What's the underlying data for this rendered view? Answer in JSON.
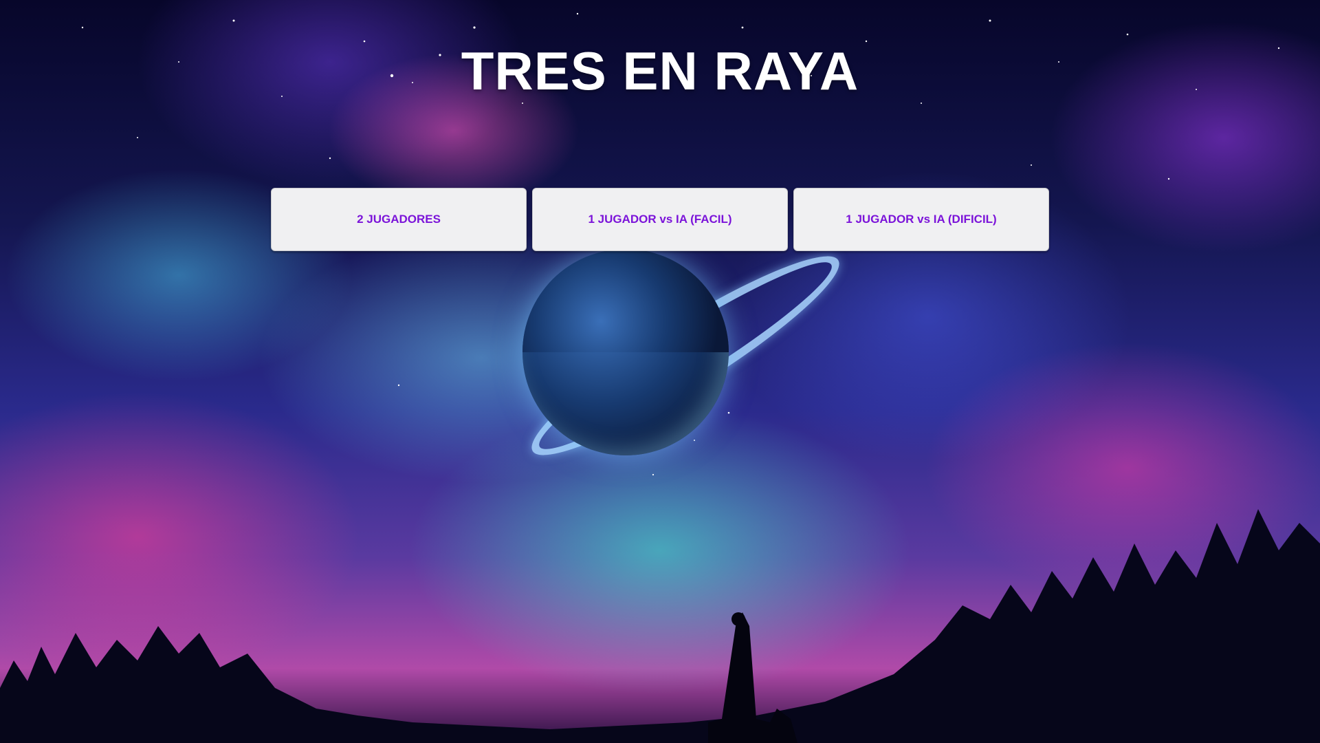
{
  "title": "TRES EN RAYA",
  "menu": {
    "buttons": [
      {
        "label": "2 JUGADORES"
      },
      {
        "label": "1 JUGADOR vs IA (FACIL)"
      },
      {
        "label": "1 JUGADOR vs IA (DIFICIL)"
      }
    ]
  },
  "colors": {
    "button_text": "#7b13d9",
    "button_background": "#f0f0f2",
    "title_text": "#ffffff"
  }
}
